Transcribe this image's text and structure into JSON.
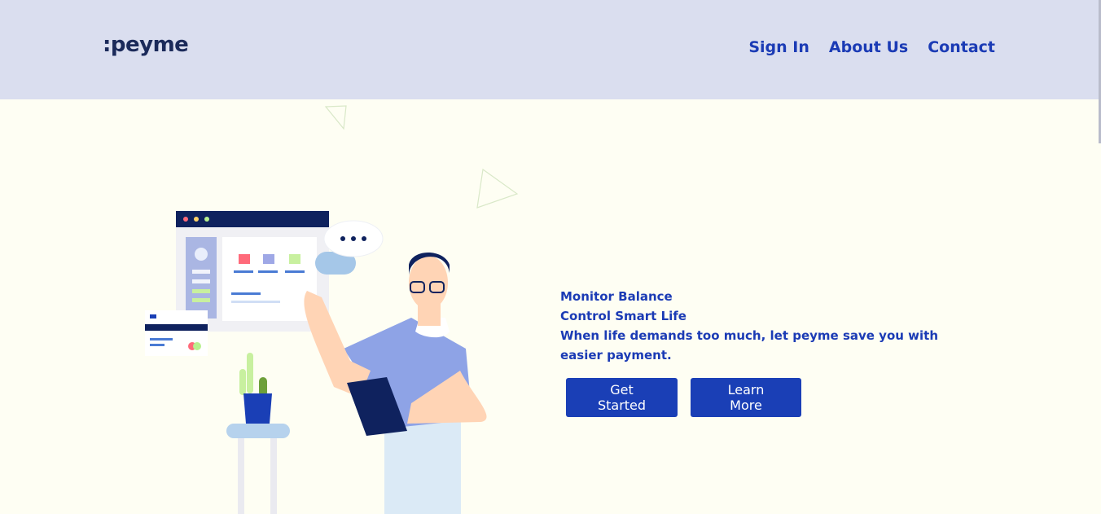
{
  "header": {
    "logo": ":peyme",
    "nav": [
      {
        "label": "Sign In"
      },
      {
        "label": "About Us"
      },
      {
        "label": "Contact"
      }
    ]
  },
  "hero": {
    "line1": "Monitor Balance",
    "line2": "Control Smart Life",
    "line3": "When life demands too much, let peyme save you with easier payment.",
    "buttons": {
      "primary": "Get Started",
      "secondary": "Learn More"
    }
  },
  "colors": {
    "header_bg": "#dadeef",
    "page_bg": "#fefef3",
    "accent": "#1a3fb6",
    "text": "#1b3bb5"
  }
}
